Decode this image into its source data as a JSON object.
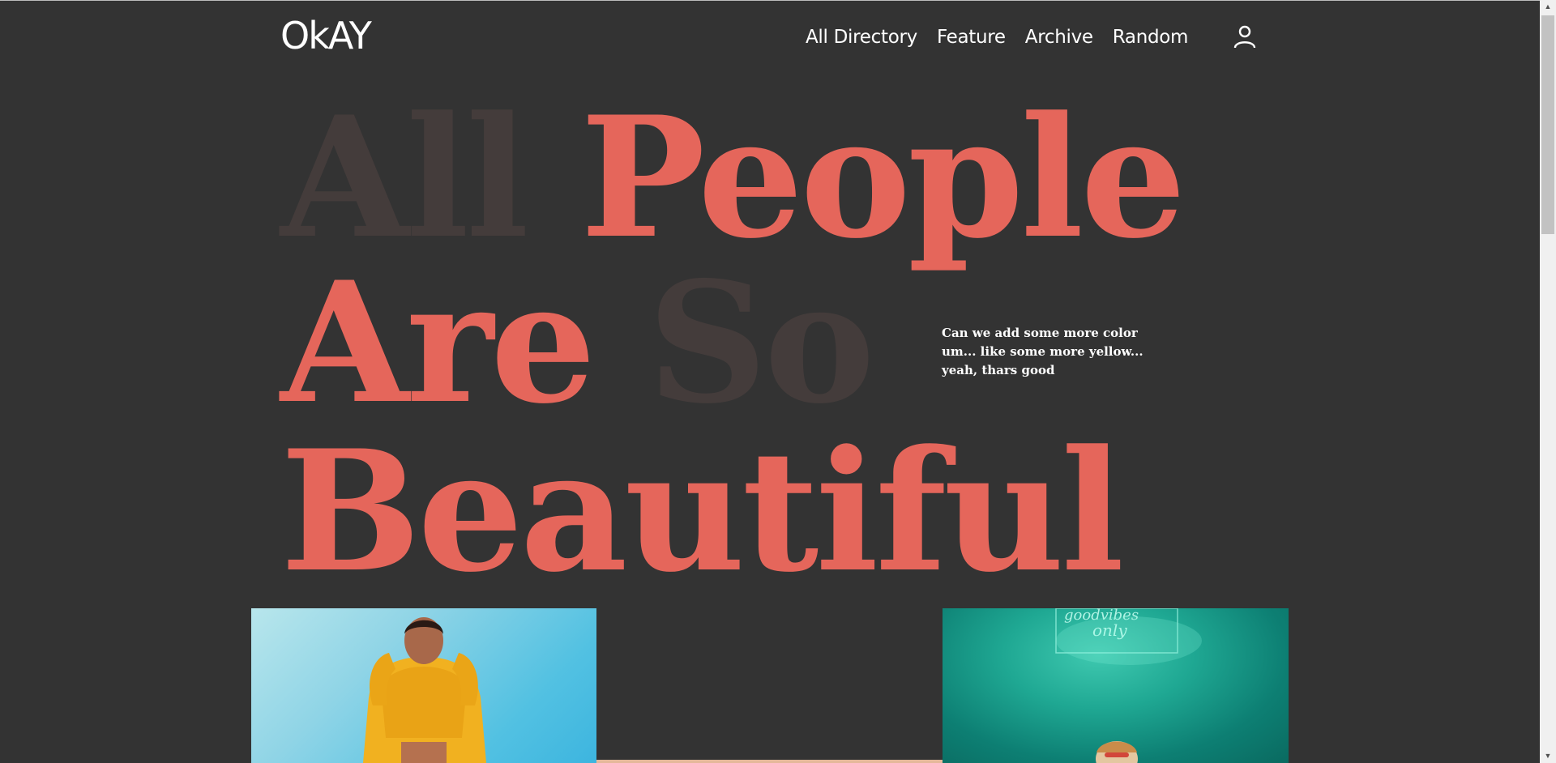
{
  "header": {
    "logo": "OkAY",
    "nav": [
      "All Directory",
      "Feature",
      "Archive",
      "Random"
    ],
    "user_icon": "user-icon"
  },
  "hero": {
    "line1": {
      "word1": "All",
      "word2": "People"
    },
    "line2": {
      "word1": "Are",
      "word2": "So"
    },
    "line3": {
      "word1": "Beautiful"
    }
  },
  "tagline": "Can we add some more color um... like some more yellow... yeah, thars good",
  "colors": {
    "background": "#333333",
    "accent": "#e5665b",
    "muted": "#443c3b",
    "text": "#ffffff"
  }
}
